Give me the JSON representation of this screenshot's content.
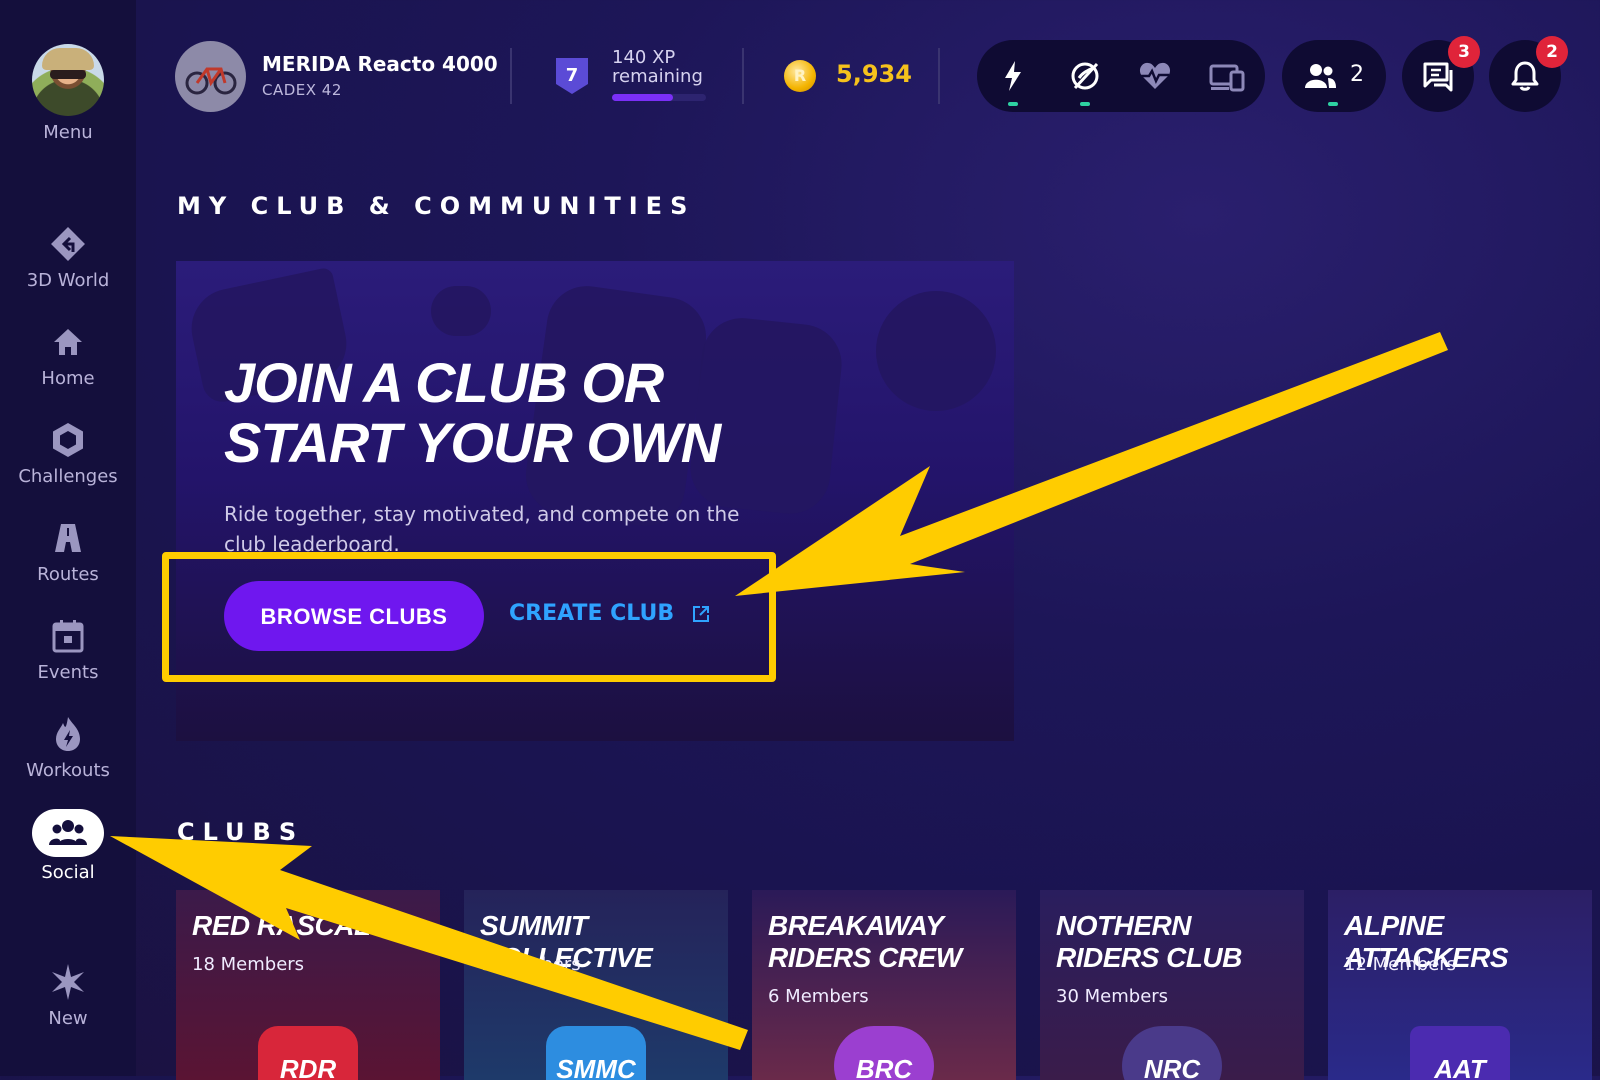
{
  "sidebar": {
    "menu_label": "Menu",
    "items": [
      {
        "label": "3D World",
        "icon": "3d-world-icon"
      },
      {
        "label": "Home",
        "icon": "home-icon"
      },
      {
        "label": "Challenges",
        "icon": "challenges-icon"
      },
      {
        "label": "Routes",
        "icon": "routes-icon"
      },
      {
        "label": "Events",
        "icon": "calendar-icon"
      },
      {
        "label": "Workouts",
        "icon": "flame-icon"
      },
      {
        "label": "Social",
        "icon": "people-icon",
        "active": true
      },
      {
        "label": "New",
        "icon": "sparkle-icon"
      }
    ]
  },
  "topbar": {
    "bike_name": "MERIDA Reacto 4000",
    "wheels": "CADEX 42",
    "level": "7",
    "xp_text_line1": "140 XP",
    "xp_text_line2": "remaining",
    "xp_progress": 0.65,
    "coins": "5,934",
    "coin_symbol": "R",
    "friends_count": "2",
    "messages_badge": "3",
    "notifications_badge": "2"
  },
  "main": {
    "section_title": "MY CLUB & COMMUNITIES",
    "hero": {
      "title": "JOIN A CLUB OR START YOUR OWN",
      "description": "Ride together, stay motivated, and compete on the club leaderboard.",
      "browse_button": "BROWSE CLUBS",
      "create_link": "CREATE CLUB"
    },
    "clubs_title": "CLUBS",
    "clubs": [
      {
        "name": "RED RASCALS",
        "members": "18 Members",
        "logo": "RDR"
      },
      {
        "name": "SUMMIT COLLECTIVE",
        "members": "8 Members",
        "logo": "SMMC"
      },
      {
        "name": "BREAKAWAY RIDERS CREW",
        "members": "6 Members",
        "logo": "BRC"
      },
      {
        "name": "NOTHERN RIDERS CLUB",
        "members": "30 Members",
        "logo": "NRC"
      },
      {
        "name": "ALPINE ATTACKERS",
        "members": "12 Members",
        "logo": "AAT"
      }
    ]
  },
  "colors": {
    "accent_purple": "#6f17ef",
    "link_blue": "#2fa3ff",
    "coin_gold": "#f6c21c",
    "annotation_yellow": "#ffcc00",
    "badge_red": "#e0243a"
  }
}
